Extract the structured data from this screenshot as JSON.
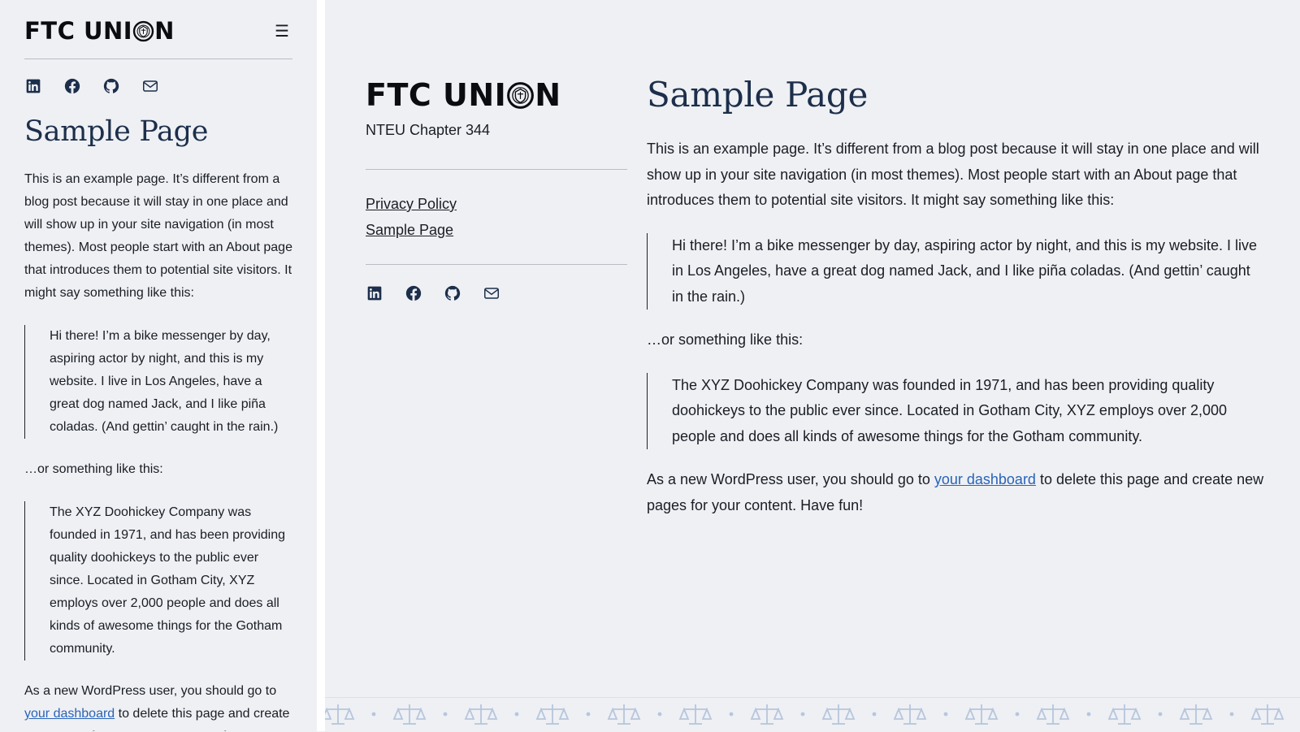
{
  "site": {
    "logo_text_start": "FTC UNI",
    "logo_text_end": "N",
    "tagline": "NTEU Chapter 344"
  },
  "social_icons": [
    "linkedin-icon",
    "facebook-icon",
    "github-icon",
    "mail-icon"
  ],
  "nav": {
    "items": [
      {
        "label": "Privacy Policy"
      },
      {
        "label": "Sample Page"
      }
    ]
  },
  "page": {
    "title": "Sample Page",
    "intro": "This is an example page. It’s different from a blog post because it will stay in one place and will show up in your site navigation (in most themes). Most people start with an About page that introduces them to potential site visitors. It might say something like this:",
    "quote1": "Hi there! I’m a bike messenger by day, aspiring actor by night, and this is my website. I live in Los Angeles, have a great dog named Jack, and I like piña coladas. (And gettin’ caught in the rain.)",
    "or_text": "…or something like this:",
    "quote2": "The XYZ Doohickey Company was founded in 1971, and has been providing quality doohickeys to the public ever since. Located in Gotham City, XYZ employs over 2,000 people and does all kinds of awesome things for the Gotham community.",
    "newuser_before": "As a new WordPress user, you should go to ",
    "newuser_link": "your dashboard",
    "newuser_after": " to delete this page and create new pages for your content. Have fun!"
  },
  "colors": {
    "title": "#1c2e4a",
    "link": "#2a63b8",
    "background": "#eef0f4",
    "pattern": "#b7c6dc"
  }
}
